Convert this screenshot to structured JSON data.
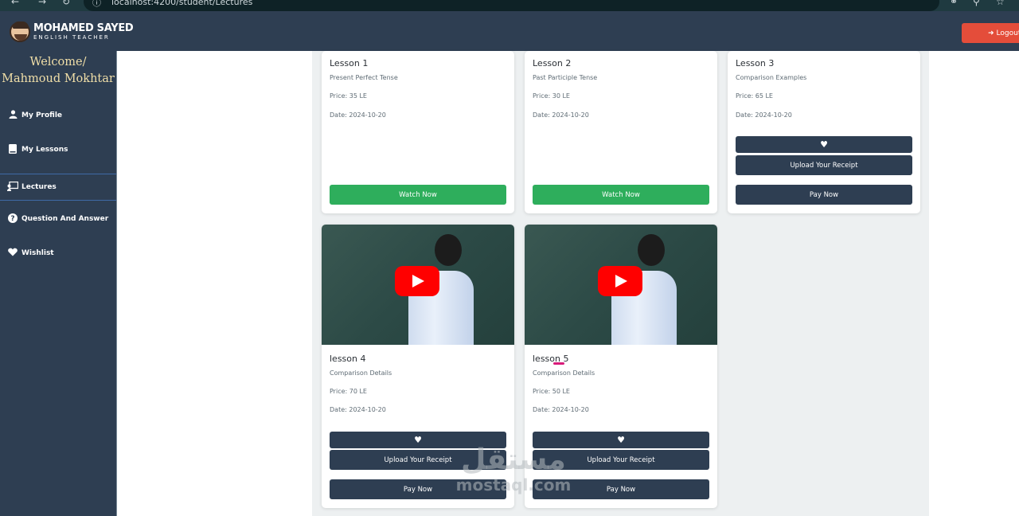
{
  "browser": {
    "url": "localhost:4200/student/Lectures",
    "back_icon": "arrow-left-icon",
    "forward_icon": "arrow-right-icon",
    "reload_icon": "reload-icon"
  },
  "navbar": {
    "logo_main": "MOHAMED SAYED",
    "logo_sub": "ENGLISH TEACHER",
    "logout_label": "Logout",
    "logout_color": "#e44d3a",
    "bg_color": "#2e3e52"
  },
  "sidebar": {
    "welcome_line1": "Welcome/",
    "welcome_line2": "Mahmoud Mokhtar",
    "items": [
      {
        "label": "My Profile",
        "icon": "user-icon"
      },
      {
        "label": "My Lessons",
        "icon": "book-icon"
      },
      {
        "label": "Lectures",
        "icon": "presentation-icon",
        "active": true
      },
      {
        "label": "Question And Answer",
        "icon": "question-circle-icon"
      },
      {
        "label": "Wishlist",
        "icon": "heart-icon"
      }
    ]
  },
  "lessons": [
    {
      "title": "Lesson 1",
      "description": "Present Perfect Tense",
      "price": "Price: 35 LE",
      "date": "Date: 2024-10-20",
      "action": "Watch Now"
    },
    {
      "title": "Lesson 2",
      "description": "Past Participle Tense",
      "price": "Price: 30 LE",
      "date": "Date: 2024-10-20",
      "action": "Watch Now"
    },
    {
      "title": "Lesson 3",
      "description": "Comparison Examples",
      "price": "Price: 65 LE",
      "date": "Date: 2024-10-20",
      "upload": "Upload Your Receipt",
      "action": "Pay Now"
    },
    {
      "title": "lesson 4",
      "description": "Comparison Details",
      "price": "Price: 70 LE",
      "date": "Date: 2024-10-20",
      "upload": "Upload Your Receipt",
      "action": "Pay Now"
    },
    {
      "title": "lesson 5",
      "description": "Comparison Details",
      "price": "Price: 50 LE",
      "date": "Date: 2024-10-20",
      "upload": "Upload Your Receipt",
      "action": "Pay Now"
    }
  ],
  "watermark": {
    "arabic": "مستقل",
    "latin": "mostaql.com"
  },
  "colors": {
    "watch_button": "#2eae5c",
    "dark_button": "#2e3e52",
    "welcome_text": "#f1dfa8"
  }
}
